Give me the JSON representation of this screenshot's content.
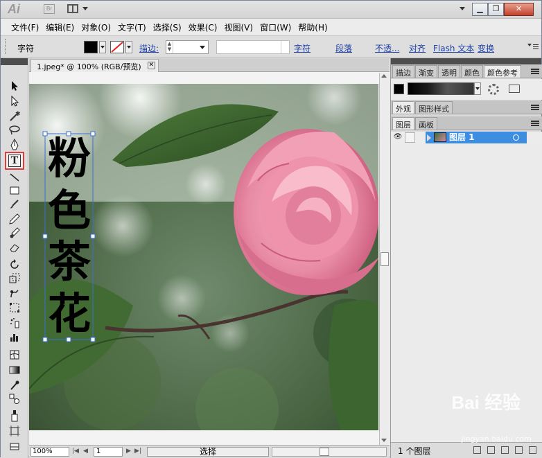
{
  "app": {
    "logo": "Ai",
    "bridge": "Br"
  },
  "menu": [
    "文件(F)",
    "编辑(E)",
    "对象(O)",
    "文字(T)",
    "选择(S)",
    "效果(C)",
    "视图(V)",
    "窗口(W)",
    "帮助(H)"
  ],
  "window_buttons": {
    "minimize": "▁",
    "restore": "❐",
    "close": "✕"
  },
  "controlbar": {
    "context_label": "字符",
    "stroke_label": "描边:",
    "links": [
      "字符",
      "段落",
      "不透...",
      "对齐",
      "Flash 文本",
      "变换"
    ]
  },
  "document": {
    "tab_title": "1.jpeg* @ 100% (RGB/预览)",
    "tab_close": "✕",
    "artwork_text": [
      "粉",
      "色",
      "茶",
      "花"
    ]
  },
  "statusbar": {
    "zoom": "100%",
    "page": "1",
    "mode": "选择"
  },
  "panels": {
    "top_tabs": [
      "描边",
      "渐变",
      "透明",
      "颜色",
      "颜色参考"
    ],
    "mid_tabs": [
      "外观",
      "图形样式"
    ],
    "layer_tabs": [
      "图层",
      "画板"
    ],
    "layer_name": "图层 1",
    "layer_count": "1 个图层"
  },
  "tools": [
    "selection-tool",
    "direct-selection-tool",
    "magic-wand-tool",
    "lasso-tool",
    "pen-tool",
    "type-tool",
    "line-tool",
    "rectangle-tool",
    "paintbrush-tool",
    "pencil-tool",
    "blob-brush-tool",
    "eraser-tool",
    "rotate-tool",
    "scale-tool",
    "warp-tool",
    "free-transform-tool",
    "symbol-sprayer-tool",
    "column-graph-tool",
    "mesh-tool",
    "gradient-tool",
    "eyedropper-tool",
    "blend-tool",
    "live-paint-tool",
    "artboard-tool",
    "slice-tool",
    "hand-tool",
    "zoom-tool"
  ],
  "watermark": {
    "brand": "Bai 经验",
    "url": "jingyan.baidu.com"
  }
}
